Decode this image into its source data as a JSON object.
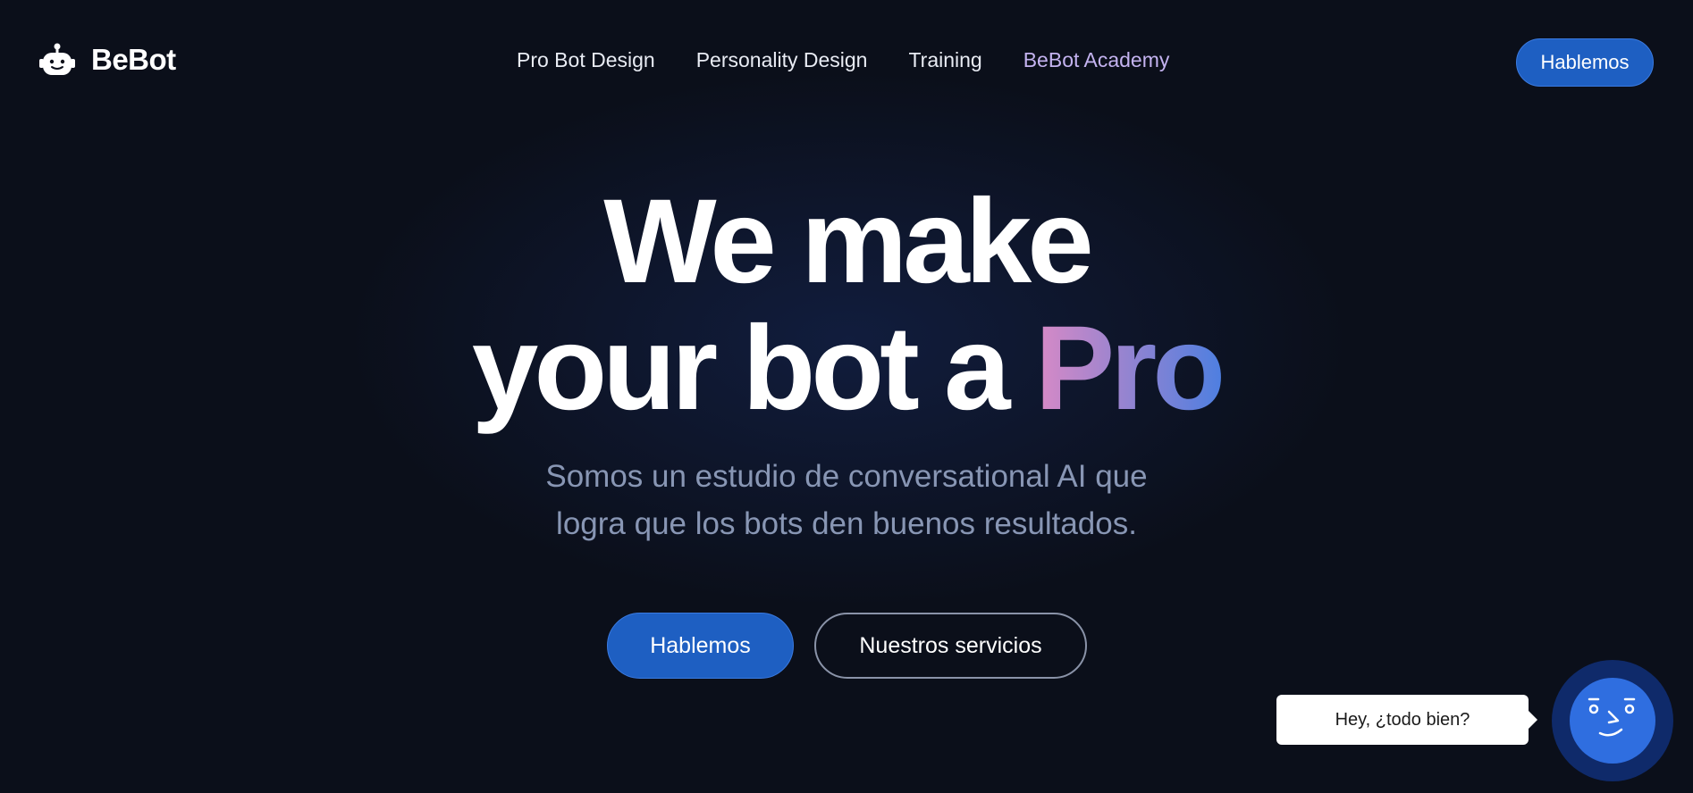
{
  "brand": {
    "name": "BeBot",
    "logo_icon": "robot-head-icon"
  },
  "nav": {
    "items": [
      {
        "label": "Pro Bot Design"
      },
      {
        "label": "Personality Design"
      },
      {
        "label": "Training"
      },
      {
        "label": "BeBot Academy"
      }
    ],
    "cta_label": "Hablemos"
  },
  "hero": {
    "line1": "We make",
    "line2_prefix": "your bot a ",
    "line2_accent": "Pro",
    "subtitle_line1": "Somos un estudio de conversational AI que",
    "subtitle_line2": "logra que los bots den buenos resultados.",
    "primary_button": "Hablemos",
    "secondary_button": "Nuestros servicios"
  },
  "chat_widget": {
    "greeting": "Hey, ¿todo bien?",
    "launcher_icon": "bot-face-icon"
  },
  "colors": {
    "background": "#0b0f1a",
    "primary": "#1e5fc2",
    "accent_nav": "#c4b3f0",
    "gradient_start": "#d98ac6",
    "gradient_end": "#4f7fe0",
    "subtitle": "#8896b4"
  }
}
